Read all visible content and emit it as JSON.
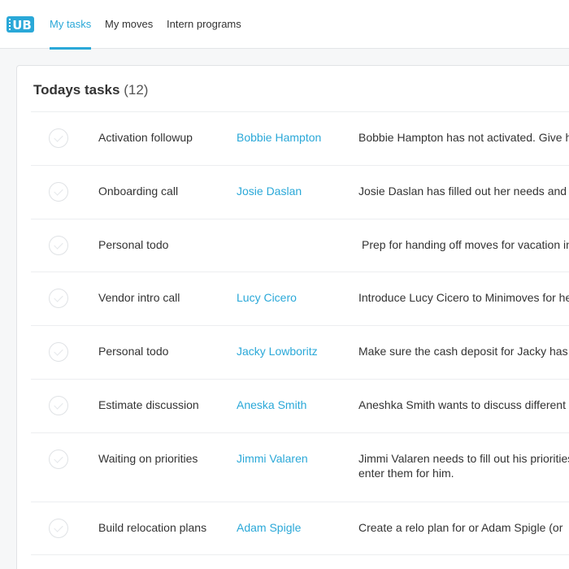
{
  "app": {
    "logo_text": "UB"
  },
  "nav": {
    "tabs": [
      {
        "label": "My tasks",
        "active": true
      },
      {
        "label": "My moves",
        "active": false
      },
      {
        "label": "Intern programs",
        "active": false
      }
    ]
  },
  "colors": {
    "accent": "#2aa8d8",
    "text": "#333333",
    "divider": "#eceef0",
    "background": "#f6f7f8"
  },
  "tasks_card": {
    "title": "Todays tasks",
    "count": "(12)",
    "rows": [
      {
        "type": "Activation followup",
        "person": "Bobbie Hampton",
        "description": "Bobbie Hampton has not activated. Give him a call"
      },
      {
        "type": "Onboarding call",
        "person": "Josie Daslan",
        "description": "Josie Daslan has filled out her needs and schedule"
      },
      {
        "type": "Personal todo",
        "person": "",
        "description": " Prep for handing off moves for vacation in June"
      },
      {
        "type": "Vendor intro call",
        "person": "Lucy Cicero",
        "description": "Introduce Lucy Cicero to Minimoves for help"
      },
      {
        "type": "Personal todo",
        "person": "Jacky Lowboritz",
        "description": "Make sure the cash deposit for Jacky has gone through"
      },
      {
        "type": "Estimate discussion",
        "person": "Aneska Smith",
        "description": "Aneshka Smith wants to discuss different estimates"
      },
      {
        "type": "Waiting on priorities",
        "person": "Jimmi Valaren",
        "description": "Jimmi Valaren needs to fill out his priorities or enter them for him."
      },
      {
        "type": "Build relocation plans",
        "person": "Adam Spigle",
        "description": "Create a relo plan for or Adam Spigle (or review)"
      },
      {
        "type": "",
        "person": "",
        "description": ""
      }
    ]
  }
}
